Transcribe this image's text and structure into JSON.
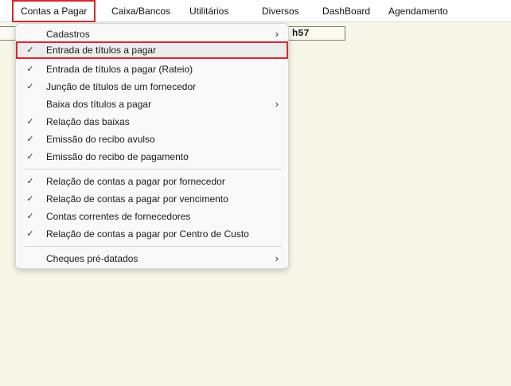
{
  "menubar": {
    "items": [
      {
        "label": "Contas a Pagar"
      },
      {
        "label": "Caixa/Bancos"
      },
      {
        "label": "Utilitários"
      },
      {
        "label": "Diversos"
      },
      {
        "label": "DashBoard"
      },
      {
        "label": "Agendamento"
      }
    ]
  },
  "underlay": {
    "field_value": "h57"
  },
  "dropdown": {
    "items": [
      {
        "label": "Cadastros",
        "checked": false,
        "submenu": true
      },
      {
        "label": "Entrada de títulos a pagar",
        "checked": true,
        "submenu": false
      },
      {
        "label": "Entrada de títulos a pagar (Rateio)",
        "checked": true,
        "submenu": false
      },
      {
        "label": "Junção de títulos de um fornecedor",
        "checked": true,
        "submenu": false
      },
      {
        "label": "Baixa dos títulos a pagar",
        "checked": false,
        "submenu": true
      },
      {
        "label": "Relação das baixas",
        "checked": true,
        "submenu": false
      },
      {
        "label": "Emissão do recibo avulso",
        "checked": true,
        "submenu": false
      },
      {
        "label": "Emissão do recibo de pagamento",
        "checked": true,
        "submenu": false
      },
      {
        "label": "Relação de contas a pagar por fornecedor",
        "checked": true,
        "submenu": false
      },
      {
        "label": "Relação de contas a pagar por vencimento",
        "checked": true,
        "submenu": false
      },
      {
        "label": "Contas correntes de fornecedores",
        "checked": true,
        "submenu": false
      },
      {
        "label": "Relação de contas a pagar por Centro de Custo",
        "checked": true,
        "submenu": false
      },
      {
        "label": "Cheques pré-datados",
        "checked": false,
        "submenu": true
      }
    ],
    "check_glyph": "✓",
    "chevron_glyph": "›"
  },
  "colors": {
    "highlight_border": "#d9282f",
    "background": "#f6f7e8",
    "menu_background": "#f9f9f9"
  }
}
